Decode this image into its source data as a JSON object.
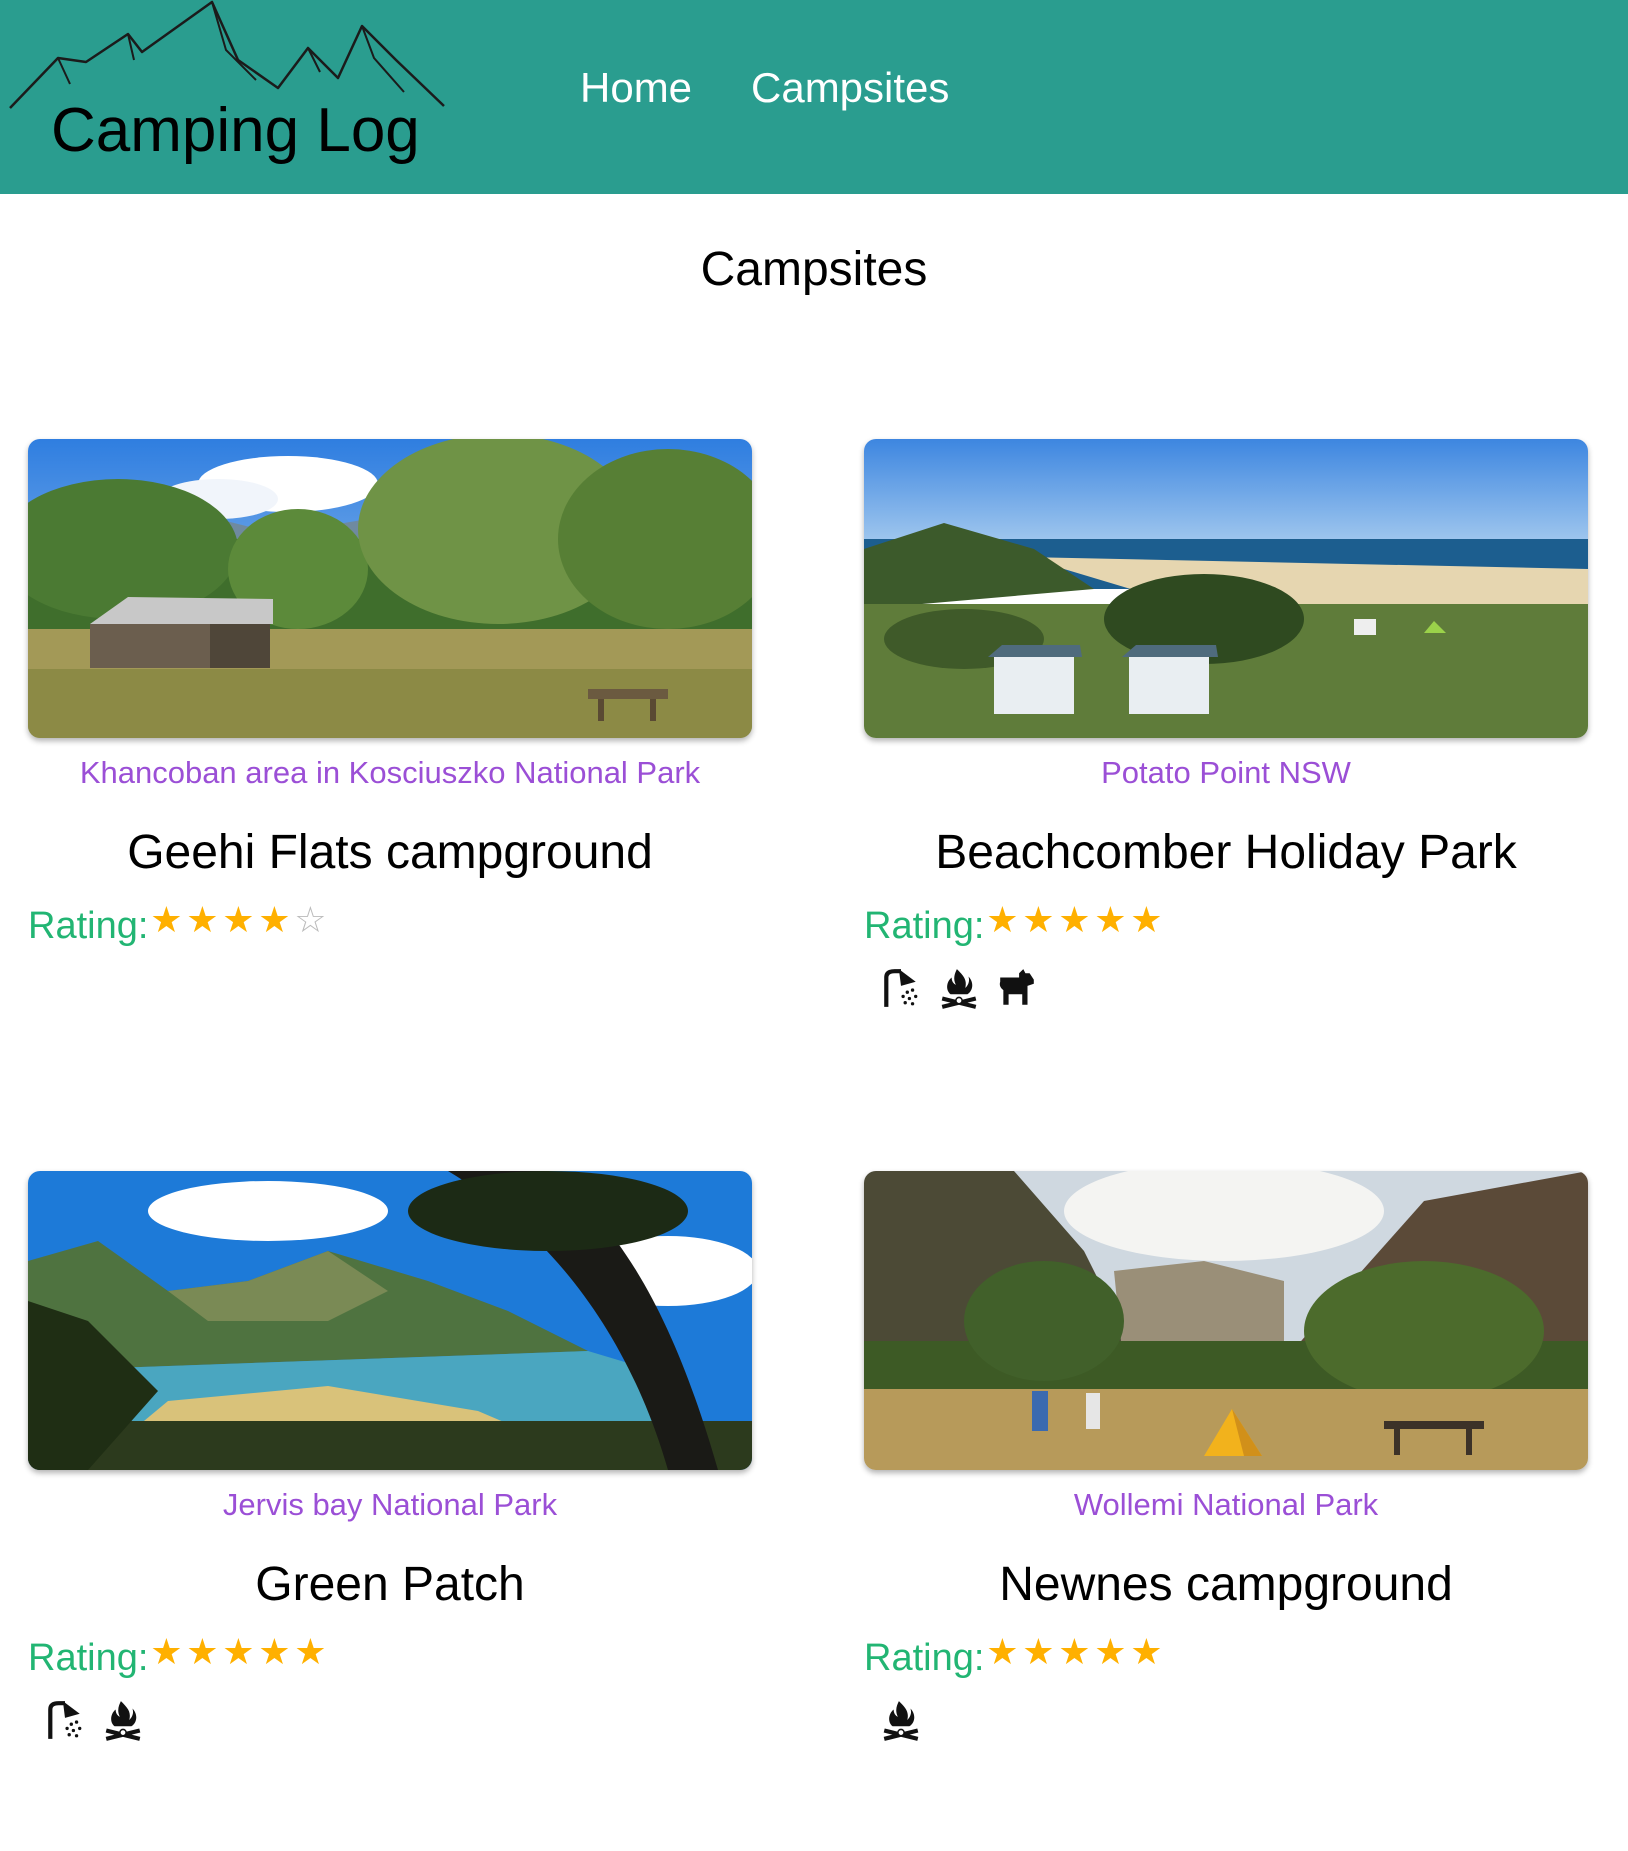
{
  "header": {
    "logo_text": "Camping Log",
    "nav": [
      {
        "label": "Home"
      },
      {
        "label": "Campsites"
      }
    ]
  },
  "page": {
    "title": "Campsites"
  },
  "colors": {
    "navbar": "#2a9d8f",
    "location": "#9b4fd6",
    "rating_label": "#22b573",
    "star": "#ffb000"
  },
  "campsites": [
    {
      "location": "Khancoban area in Kosciuszko National Park",
      "name": "Geehi Flats campground",
      "rating_label": "Rating:",
      "rating": 4,
      "max_rating": 5,
      "amenities": []
    },
    {
      "location": "Potato Point NSW",
      "name": "Beachcomber Holiday Park",
      "rating_label": "Rating:",
      "rating": 5,
      "max_rating": 5,
      "amenities": [
        "shower-icon",
        "campfire-icon",
        "dog-icon"
      ]
    },
    {
      "location": "Jervis bay National Park",
      "name": "Green Patch",
      "rating_label": "Rating:",
      "rating": 5,
      "max_rating": 5,
      "amenities": [
        "shower-icon",
        "campfire-icon"
      ]
    },
    {
      "location": "Wollemi National Park",
      "name": "Newnes campground",
      "rating_label": "Rating:",
      "rating": 5,
      "max_rating": 5,
      "amenities": [
        "campfire-icon"
      ]
    }
  ]
}
